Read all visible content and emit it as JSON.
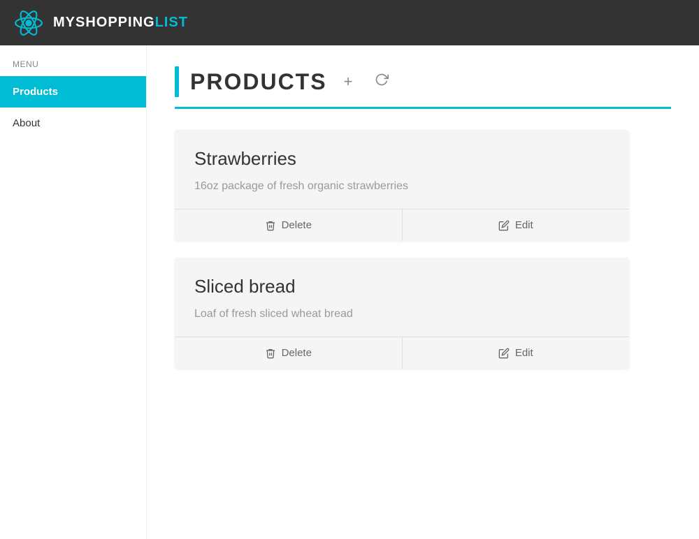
{
  "navbar": {
    "title_my": "MY",
    "title_shopping": "SHOPPING",
    "title_list": "LIST"
  },
  "sidebar": {
    "menu_label": "MENU",
    "items": [
      {
        "id": "products",
        "label": "Products",
        "active": true
      },
      {
        "id": "about",
        "label": "About",
        "active": false
      }
    ]
  },
  "main": {
    "page_title": "PRODUCTS",
    "add_button_label": "+",
    "refresh_button_label": "↻",
    "products": [
      {
        "id": 1,
        "name": "Strawberries",
        "description": "16oz package of fresh organic strawberries",
        "delete_label": "Delete",
        "edit_label": "Edit"
      },
      {
        "id": 2,
        "name": "Sliced bread",
        "description": "Loaf of fresh sliced wheat bread",
        "delete_label": "Delete",
        "edit_label": "Edit"
      }
    ]
  }
}
